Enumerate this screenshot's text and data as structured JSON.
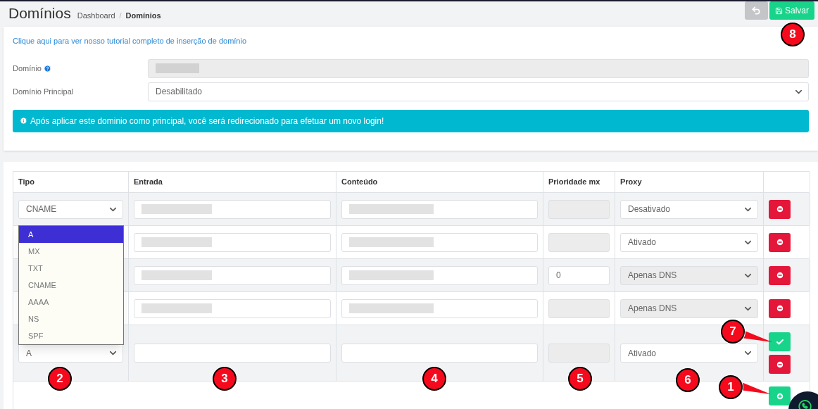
{
  "header": {
    "title": "Domínios",
    "separator": "/",
    "breadcrumb": [
      {
        "label": "Dashboard",
        "current": false
      },
      {
        "label": "Domínios",
        "current": true
      }
    ],
    "buttons": [
      {
        "kind": "back"
      },
      {
        "kind": "save",
        "label": "Salvar",
        "marker": "8"
      }
    ]
  },
  "settings": {
    "tutorial_link": "Clique aqui para ver nosso tutorial completo de inserção de domínio",
    "fields": [
      {
        "kind": "text",
        "label": "Domínio",
        "help": true,
        "disabled": true,
        "blurred": true
      },
      {
        "kind": "select",
        "label": "Domínio Principal",
        "value": "Desabilitado"
      }
    ],
    "alert": "Após aplicar este dominio como principal, você será redirecionado para efetuar um novo login!"
  },
  "records": {
    "columns": [
      "Tipo",
      "Entrada",
      "Conteúdo",
      "Prioridade mx",
      "Proxy"
    ],
    "rows": [
      {
        "type": "CNAME",
        "entry_blurred": true,
        "content_blurred": true,
        "priority": {
          "disabled": true
        },
        "proxy": {
          "value": "Desativado",
          "disabled": false
        },
        "actions": [
          {
            "kind": "remove"
          }
        ]
      },
      {
        "entry_blurred": true,
        "content_blurred": true,
        "priority": {
          "disabled": true
        },
        "proxy": {
          "value": "Ativado",
          "disabled": false
        },
        "actions": [
          {
            "kind": "remove"
          }
        ]
      },
      {
        "entry_blurred": true,
        "content_blurred": true,
        "priority": {
          "value": "0",
          "disabled": false
        },
        "proxy": {
          "value": "Apenas DNS",
          "disabled": true
        },
        "actions": [
          {
            "kind": "remove"
          }
        ]
      },
      {
        "entry_blurred": true,
        "content_blurred": true,
        "priority": {
          "disabled": true
        },
        "proxy": {
          "value": "Apenas DNS",
          "disabled": true
        },
        "actions": [
          {
            "kind": "remove"
          }
        ]
      },
      {
        "type": "A",
        "entry_blurred": false,
        "content_blurred": false,
        "priority": {
          "disabled": true
        },
        "proxy": {
          "value": "Ativado",
          "disabled": false
        },
        "actions": [
          {
            "kind": "confirm"
          },
          {
            "kind": "remove"
          }
        ],
        "markers": [
          "2",
          "3",
          "4",
          "5",
          "6"
        ],
        "confirm_marker": "7"
      }
    ],
    "type_dropdown": {
      "options": [
        {
          "label": "A",
          "selected": true
        },
        {
          "label": "MX",
          "selected": false
        },
        {
          "label": "TXT",
          "selected": false
        },
        {
          "label": "CNAME",
          "selected": false
        },
        {
          "label": "AAAA",
          "selected": false
        },
        {
          "label": "NS",
          "selected": false
        },
        {
          "label": "SPF",
          "selected": false
        }
      ]
    },
    "add_marker": "1"
  },
  "chat_button": true
}
